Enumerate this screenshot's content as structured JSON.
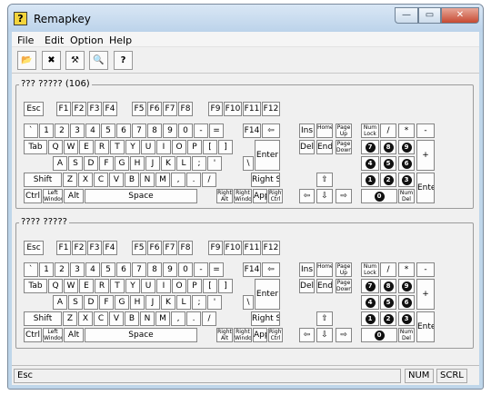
{
  "window": {
    "title": "Remapkey",
    "icon_glyph": "?",
    "minimize_glyph": "—",
    "maximize_glyph": "▭",
    "close_glyph": "✕"
  },
  "menu": [
    "File",
    "Edit",
    "Option",
    "Help"
  ],
  "toolbar": [
    {
      "icon": "open-folder-icon",
      "glyph": "📂"
    },
    {
      "icon": "remove-icon",
      "glyph": "✖"
    },
    {
      "icon": "tools-icon",
      "glyph": "⚒"
    },
    {
      "icon": "view-icon",
      "glyph": "🔍"
    },
    {
      "icon": "help-icon",
      "glyph": "?"
    }
  ],
  "groups": [
    {
      "title": "??? ????? (106)",
      "highlight_key": "",
      "selected_key": ""
    },
    {
      "title": "???? ?????",
      "highlight_key": "Caps",
      "selected_key": "Caps"
    }
  ],
  "keys": {
    "Esc": "Esc",
    "F1": "F1",
    "F2": "F2",
    "F3": "F3",
    "F4": "F4",
    "F5": "F5",
    "F6": "F6",
    "F7": "F7",
    "F8": "F8",
    "F9": "F9",
    "F10": "F10",
    "F11": "F11",
    "F12": "F12",
    "Grave": "`",
    "1": "1",
    "2": "2",
    "3": "3",
    "4": "4",
    "5": "5",
    "6": "6",
    "7": "7",
    "8": "8",
    "9": "9",
    "0": "0",
    "Minus": "-",
    "Equal": "=",
    "F14": "F14",
    "Back": "⇦",
    "Tab": "Tab",
    "Q": "Q",
    "W": "W",
    "E": "E",
    "R": "R",
    "T": "T",
    "Y": "Y",
    "U": "U",
    "I": "I",
    "O": "O",
    "P": "P",
    "LBr": "[",
    "RBr": "]",
    "Enter": "Enter",
    "A": "A",
    "S": "S",
    "D": "D",
    "F": "F",
    "G": "G",
    "H": "H",
    "J": "J",
    "K": "K",
    "L": "L",
    "Semi": ";",
    "Quote": "'",
    "BSlash": "\\",
    "Shift": "Shift",
    "Z": "Z",
    "X": "X",
    "C": "C",
    "V": "V",
    "B": "B",
    "N": "N",
    "M": "M",
    "Comma": ",",
    "Period": ".",
    "Slash": "/",
    "RShift": "Right Shift",
    "Ctrl": "Ctrl",
    "LWin": "Left Windows",
    "Alt": "Alt",
    "Space": "Space",
    "RAlt": "Right Alt",
    "RWin": "Right Windows",
    "App": "App",
    "RCtrl": "Right Ctrl",
    "Ins": "Ins",
    "Home": "Home",
    "PgUp": "Page Up",
    "Del": "Del",
    "End": "End",
    "PgDn": "Page Down",
    "Up": "⇧",
    "Left": "⇦",
    "Down": "⇩",
    "Right": "⇨",
    "NumLock": "Num Lock",
    "NumDiv": "/",
    "NumMul": "*",
    "NumSub": "-",
    "NumAdd": "+",
    "NumEnter": "Enter",
    "NumDel": "Num Del",
    "N0": "0",
    "N1": "1",
    "N2": "2",
    "N3": "3",
    "N4": "4",
    "N5": "5",
    "N6": "6",
    "N7": "7",
    "N8": "8",
    "N9": "9"
  },
  "statusbar": {
    "message": "Esc",
    "num": "NUM",
    "scrl": "SCRL"
  },
  "colors": {
    "highlight": "#c00000",
    "titlebar": "#bcd3ea"
  }
}
